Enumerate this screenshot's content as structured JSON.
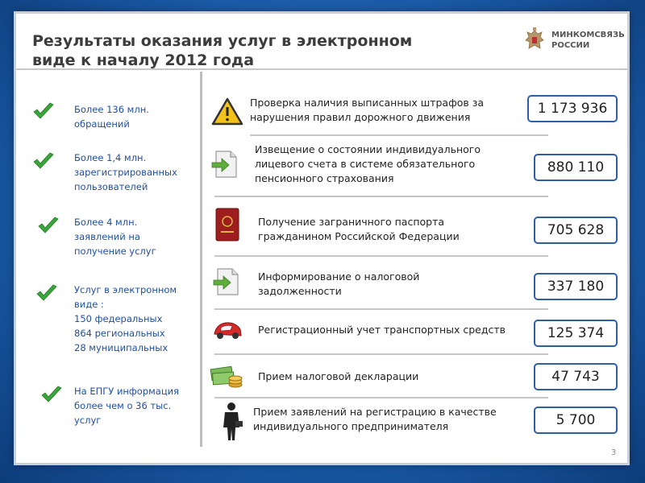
{
  "title": "Результаты оказания услуг в электронном виде к началу 2012 года",
  "logo": {
    "line1": "МИНКОМСВЯЗЬ",
    "line2": "РОССИИ"
  },
  "left_items": [
    {
      "lines": [
        "Более 136 млн.",
        "обращений"
      ]
    },
    {
      "lines": [
        "Более 1,4 млн.",
        "зарегистрированных",
        "пользователей"
      ]
    },
    {
      "lines": [
        "Более 4 млн.",
        "заявлений на",
        "получение услуг"
      ]
    },
    {
      "lines": [
        "Услуг в электронном",
        "виде :",
        "150 федеральных",
        "864 региональных",
        "28 муниципальных"
      ]
    },
    {
      "lines": [
        "На ЕПГУ информация",
        "более чем о 36 тыс.",
        "услуг"
      ]
    }
  ],
  "services": [
    {
      "icon": "warning-icon",
      "lines": [
        "Проверка наличия выписанных штрафов за",
        "нарушения правил дорожного движения"
      ],
      "value": "1 173 936"
    },
    {
      "icon": "document-arrow-icon",
      "lines": [
        "Извещение о состоянии индивидуального",
        "лицевого счета в системе обязательного",
        "пенсионного страхования"
      ],
      "value": "880 110"
    },
    {
      "icon": "passport-icon",
      "lines": [
        "Получение заграничного паспорта",
        "гражданином Российской Федерации"
      ],
      "value": "705 628"
    },
    {
      "icon": "document-arrow-icon",
      "lines": [
        "Информирование о налоговой",
        "задолженности"
      ],
      "value": "337 180"
    },
    {
      "icon": "car-icon",
      "lines": [
        "Регистрационный учет транспортных средств"
      ],
      "value": "125 374"
    },
    {
      "icon": "money-icon",
      "lines": [
        "Прием налоговой декларации"
      ],
      "value": "47 743"
    },
    {
      "icon": "businessman-icon",
      "lines": [
        "Прием заявлений на регистрацию в качестве",
        "индивидуального предпринимателя"
      ],
      "value": "5 700"
    }
  ],
  "page_number": "3",
  "colors": {
    "accent": "#2f5ea8",
    "left_text": "#2050a0",
    "check": "#3aa53a"
  }
}
